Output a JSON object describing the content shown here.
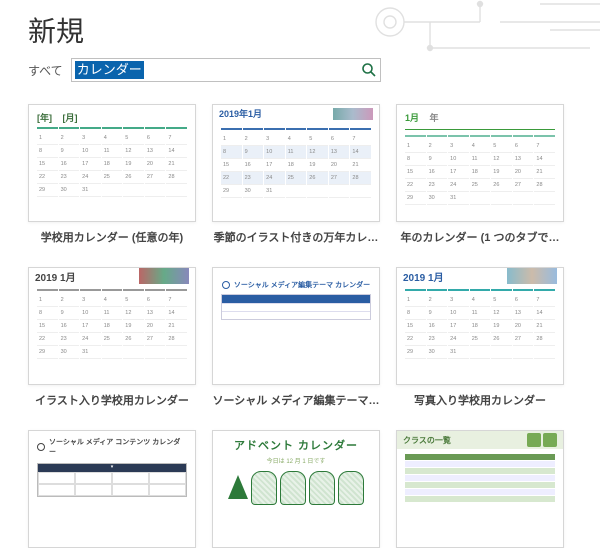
{
  "header": {
    "title": "新規"
  },
  "search": {
    "scope_label": "すべて",
    "value": "カレンダー",
    "placeholder": ""
  },
  "templates": [
    {
      "caption": "学校用カレンダー (任意の年)",
      "heading_left": "[年]",
      "heading_right": "[月]",
      "style": "green"
    },
    {
      "caption": "季節のイラスト付きの万年カレ…",
      "heading": "2019年1月",
      "style": "blue-striped"
    },
    {
      "caption": "年のカレンダー (1 つのタブで…",
      "heading_left": "1月",
      "heading_right": "年",
      "style": "green-light"
    },
    {
      "caption": "イラスト入り学校用カレンダー",
      "heading": "2019 1月",
      "style": "photo-strip"
    },
    {
      "caption": "ソーシャル メディア編集テーマ…",
      "heading": "ソーシャル メディア編集テーマ カレンダー",
      "style": "table-blue"
    },
    {
      "caption": "写真入り学校用カレンダー",
      "heading": "2019 1月",
      "style": "photo-strip-teal"
    },
    {
      "caption": "",
      "heading": "ソーシャル メディア コンテンツ カレンダー",
      "style": "table-dark"
    },
    {
      "caption": "",
      "heading": "アドベント カレンダー",
      "subheading": "今日は 12 月 1 日です",
      "style": "advent"
    },
    {
      "caption": "",
      "heading": "クラスの一覧",
      "style": "class-list"
    }
  ],
  "mini_days": [
    "1",
    "2",
    "3",
    "4",
    "5",
    "6",
    "7",
    "8",
    "9",
    "10",
    "11",
    "12",
    "13",
    "14",
    "15",
    "16",
    "17",
    "18",
    "19",
    "20",
    "21",
    "22",
    "23",
    "24",
    "25",
    "26",
    "27",
    "28",
    "29",
    "30",
    "31",
    "",
    "",
    "",
    ""
  ]
}
